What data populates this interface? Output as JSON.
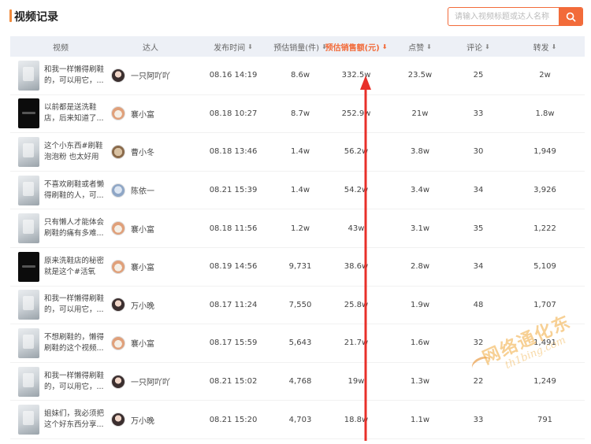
{
  "header": {
    "title": "视频记录",
    "search_placeholder": "请输入视频标题或达人名称"
  },
  "colors": {
    "accent": "#f26b3a",
    "header_bg": "#edf0f6"
  },
  "table": {
    "columns": [
      {
        "key": "video",
        "label": "视频",
        "sortable": false
      },
      {
        "key": "talent",
        "label": "达人",
        "sortable": false
      },
      {
        "key": "date",
        "label": "发布时间",
        "sortable": true
      },
      {
        "key": "sales",
        "label": "预估销量(件)",
        "sortable": true
      },
      {
        "key": "gmv",
        "label": "预估销售额(元)",
        "sortable": true,
        "sorted": true
      },
      {
        "key": "likes",
        "label": "点赞",
        "sortable": true
      },
      {
        "key": "comments",
        "label": "评论",
        "sortable": true
      },
      {
        "key": "shares",
        "label": "转发",
        "sortable": true
      }
    ],
    "rows": [
      {
        "title": "和我一样懒得刷鞋的，可以用它，...",
        "thumb": "light",
        "talent": "一只阿吖吖",
        "avatar": "girl",
        "date": "08.16 14:19",
        "sales": "8.6w",
        "gmv": "332.5w",
        "likes": "23.5w",
        "comments": "25",
        "shares": "2w"
      },
      {
        "title": "以前都是送洗鞋店，后来知道了...",
        "thumb": "dark",
        "talent": "褰小富",
        "avatar": "cat",
        "date": "08.18 10:27",
        "sales": "8.7w",
        "gmv": "252.9w",
        "likes": "21w",
        "comments": "33",
        "shares": "1.8w"
      },
      {
        "title": "这个小东西#刷鞋泡泡粉 也太好用了...",
        "thumb": "light",
        "talent": "曹小冬",
        "avatar": "dog",
        "date": "08.18 13:46",
        "sales": "1.4w",
        "gmv": "56.2w",
        "likes": "3.8w",
        "comments": "30",
        "shares": "1,949"
      },
      {
        "title": "不喜欢刷鞋或者懒得刷鞋的人，可...",
        "thumb": "light",
        "talent": "陈依一",
        "avatar": "blue",
        "date": "08.21 15:39",
        "sales": "1.4w",
        "gmv": "54.2w",
        "likes": "3.4w",
        "comments": "34",
        "shares": "3,926"
      },
      {
        "title": "只有懒人才能体会刷鞋的痛有多难...",
        "thumb": "light",
        "talent": "褰小富",
        "avatar": "cat",
        "date": "08.18 11:56",
        "sales": "1.2w",
        "gmv": "43w",
        "likes": "3.1w",
        "comments": "35",
        "shares": "1,222"
      },
      {
        "title": "原来洗鞋店的秘密就是这个#活氧泡...",
        "thumb": "dark",
        "talent": "褰小富",
        "avatar": "cat",
        "date": "08.19 14:56",
        "sales": "9,731",
        "gmv": "38.6w",
        "likes": "2.8w",
        "comments": "34",
        "shares": "5,109"
      },
      {
        "title": "和我一样懒得刷鞋的，可以用它，...",
        "thumb": "light",
        "talent": "万小晚",
        "avatar": "girl",
        "date": "08.17 11:24",
        "sales": "7,550",
        "gmv": "25.8w",
        "likes": "1.9w",
        "comments": "48",
        "shares": "1,707"
      },
      {
        "title": "不想刷鞋的，懒得刷鞋的这个视频...",
        "thumb": "light",
        "talent": "褰小富",
        "avatar": "cat",
        "date": "08.17 15:59",
        "sales": "5,643",
        "gmv": "21.7w",
        "likes": "1.6w",
        "comments": "32",
        "shares": "1,491"
      },
      {
        "title": "和我一样懒得刷鞋的，可以用它，...",
        "thumb": "light",
        "talent": "一只阿吖吖",
        "avatar": "girl",
        "date": "08.21 15:02",
        "sales": "4,768",
        "gmv": "19w",
        "likes": "1.3w",
        "comments": "22",
        "shares": "1,249"
      },
      {
        "title": "姐妹们，我必须把这个好东西分享...",
        "thumb": "light",
        "talent": "万小晚",
        "avatar": "girl",
        "date": "08.21 15:20",
        "sales": "4,703",
        "gmv": "18.8w",
        "likes": "1.1w",
        "comments": "33",
        "shares": "791"
      }
    ]
  },
  "watermark": {
    "main": "网络通化东",
    "sub": "th1bing.com"
  }
}
